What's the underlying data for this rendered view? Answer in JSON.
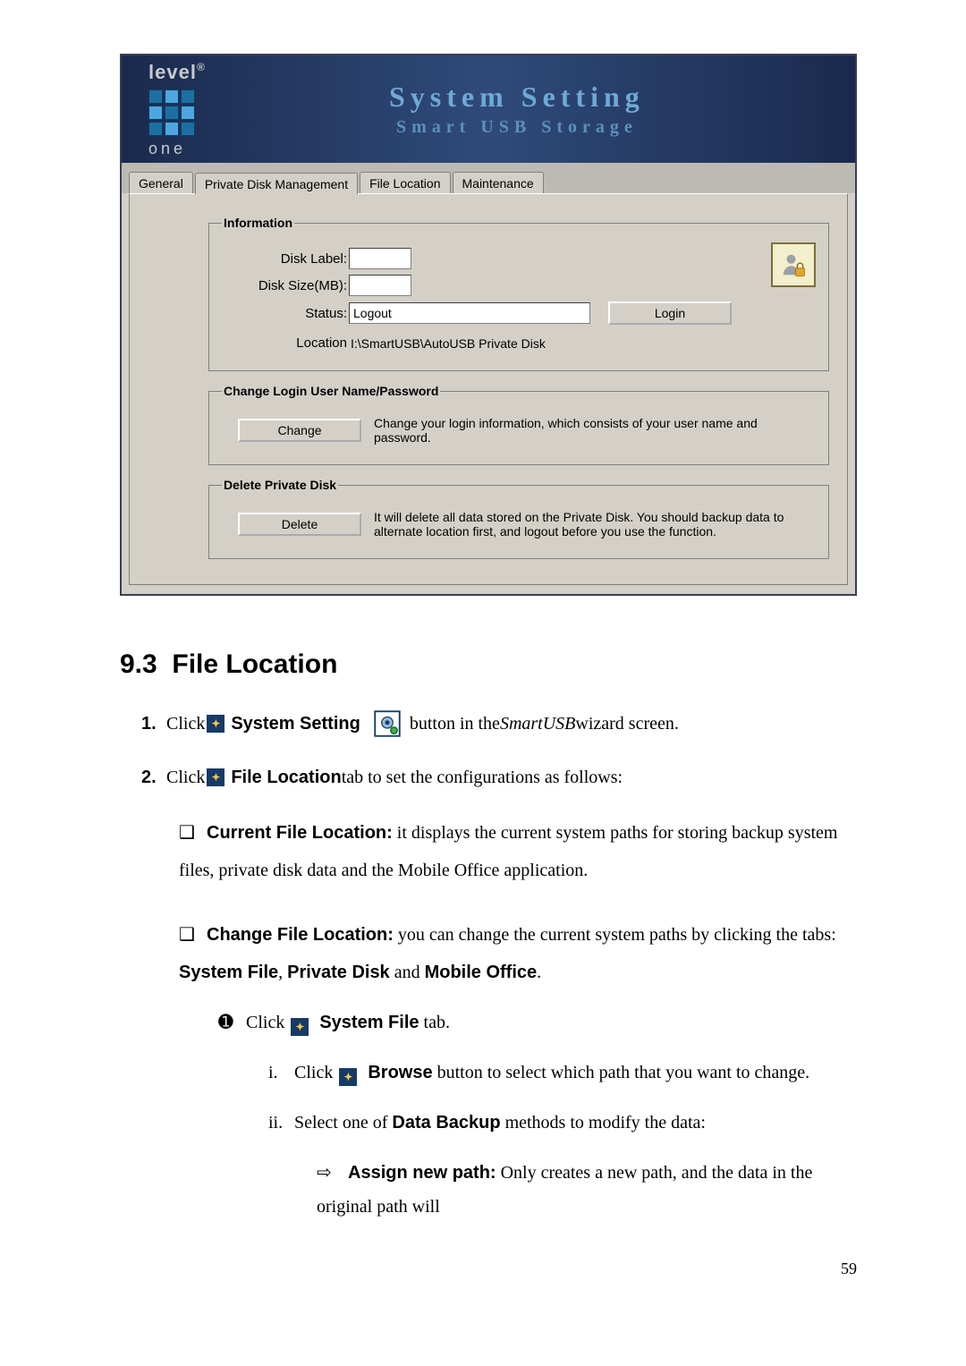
{
  "app": {
    "logo_main": "level",
    "logo_reg": "®",
    "logo_sub": "one",
    "title": "System Setting",
    "subtitle": "Smart USB Storage",
    "tabs": {
      "general": "General",
      "pdm": "Private Disk Management",
      "fileloc": "File Location",
      "maint": "Maintenance"
    },
    "info": {
      "legend": "Information",
      "disk_label_lbl": "Disk Label:",
      "disk_label_val": "",
      "disk_size_lbl": "Disk Size(MB):",
      "disk_size_val": "",
      "status_lbl": "Status:",
      "status_val": "Logout",
      "login_btn": "Login",
      "location_lbl": "Location",
      "location_val": "I:\\SmartUSB\\AutoUSB Private Disk"
    },
    "change": {
      "legend": "Change Login User Name/Password",
      "btn": "Change",
      "desc": "Change your login information, which consists of your user name and password."
    },
    "del": {
      "legend": "Delete Private Disk",
      "btn": "Delete",
      "desc": "It will delete all data stored on the Private Disk. You should backup data to alternate location first, and logout before you use the function."
    }
  },
  "doc": {
    "heading_num": "9.3",
    "heading_title": "File Location",
    "step1_a": "Click ",
    "step1_b": "System Setting",
    "step1_c": " button in the ",
    "step1_d": "SmartUSB",
    "step1_e": " wizard screen.",
    "step2_a": "Click ",
    "step2_b": "File Location",
    "step2_c": " tab to set the configurations as follows:",
    "b1_a": "Current File Location:",
    "b1_b": " it displays the current system paths for storing backup system files, private disk data and the Mobile Office application.",
    "b2_a": "Change File Location:",
    "b2_b": " you can change the current system paths by clicking the tabs: ",
    "b2_c": "System File",
    "b2_d": ", ",
    "b2_e": "Private Disk",
    "b2_f": " and ",
    "b2_g": "Mobile Office",
    "b2_h": ".",
    "c1_a": "Click ",
    "c1_b": "System File",
    "c1_c": " tab.",
    "r1_a": "Click ",
    "r1_b": "Browse",
    "r1_c": " button to select which path that you want to change.",
    "r2_a": "Select one of ",
    "r2_b": "Data Backup",
    "r2_c": " methods to modify the data:",
    "a1_a": "Assign new path:",
    "a1_b": " Only creates a new path, and the data in the original path will",
    "page_no": "59",
    "num1": "1.",
    "num2": "2.",
    "sq": "❑",
    "circ1": "➊",
    "ri": "i.",
    "rii": "ii.",
    "arrow": "⇨"
  }
}
